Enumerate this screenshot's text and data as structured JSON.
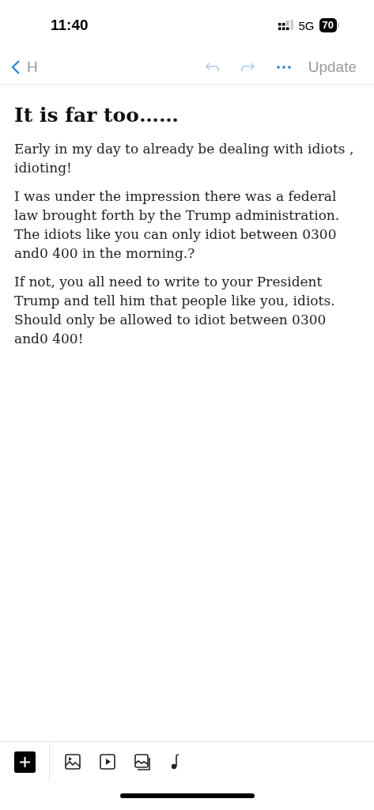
{
  "status_bar": {
    "time": "11:40",
    "network": "5G",
    "battery": "70"
  },
  "nav_bar": {
    "back_label": "H",
    "undo_disabled": true,
    "redo_disabled": true,
    "update_button": {
      "label": "Update",
      "disabled": true
    }
  },
  "article": {
    "title": "It is far too……",
    "paragraphs": [
      "Early in my day to already be dealing with idiots , idioting!",
      "I was under the impression there was a federal law brought forth by the Trump administration. The idiots like you can only idiot between 0300 and0 400 in the morning.?",
      "If not, you all need to write to your President Trump and tell him that people like you, idiots. Should only be allowed to idiot between 0300 and0 400!"
    ]
  },
  "toolbar": {
    "tools": [
      {
        "kind": "image"
      },
      {
        "kind": "video"
      },
      {
        "kind": "gallery"
      },
      {
        "kind": "audio"
      }
    ]
  }
}
